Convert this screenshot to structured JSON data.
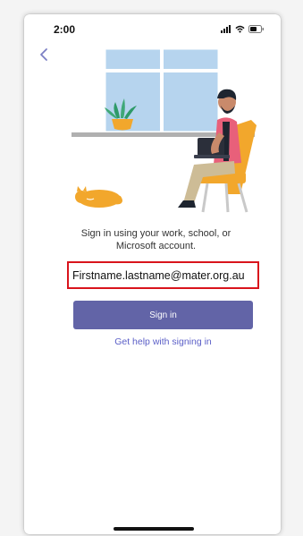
{
  "status_bar": {
    "time": "2:00",
    "icons": [
      "signal-icon",
      "wifi-icon",
      "battery-icon"
    ]
  },
  "navigation": {
    "back_icon": "chevron-left-icon"
  },
  "illustration": {
    "name": "person-working-at-laptop-illustration"
  },
  "signin": {
    "instruction": "Sign in using your work, school, or Microsoft account.",
    "email_value": "Firstname.lastname@mater.org.au",
    "button_label": "Sign in",
    "help_link": "Get help with signing in"
  },
  "colors": {
    "brand": "#6264a7",
    "link": "#5b5fc7",
    "highlight_border": "#d9141c"
  }
}
